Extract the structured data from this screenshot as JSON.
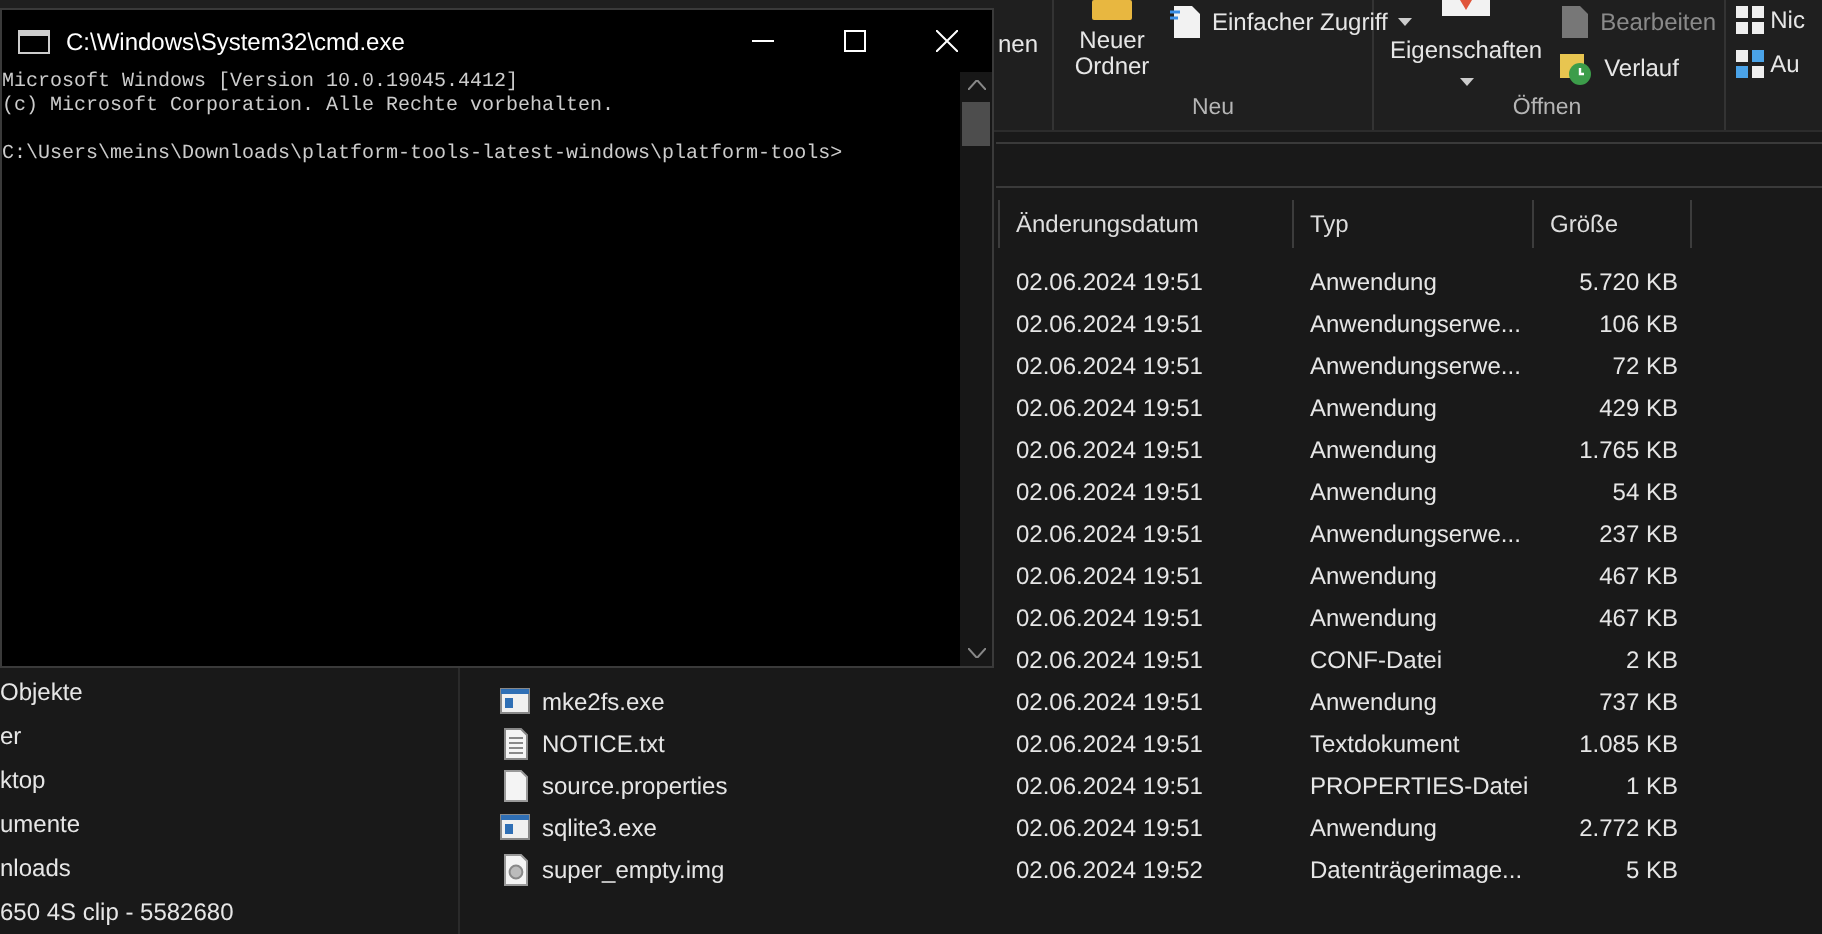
{
  "explorer": {
    "ribbon": {
      "cut_label": "nen",
      "groups": [
        {
          "label": "Neu",
          "large": {
            "label": "Neuer Ordner"
          },
          "small": [
            {
              "label": "Einfacher Zugriff",
              "caret": true
            }
          ]
        },
        {
          "label": "Öffnen",
          "large": {
            "label": "Eigenschaften",
            "caret": true
          },
          "small": [
            {
              "label": "Bearbeiten",
              "disabled": true
            },
            {
              "label": "Verlauf"
            }
          ]
        }
      ],
      "cut_items": [
        {
          "label": "Nic"
        },
        {
          "label": "Au"
        }
      ]
    },
    "sidebar": {
      "items": [
        "Objekte",
        "er",
        "ktop",
        "umente",
        "nloads",
        "650 4S clip - 5582680"
      ]
    },
    "columns": [
      "Änderungsdatum",
      "Typ",
      "Größe"
    ],
    "rows": [
      {
        "date": "02.06.2024 19:51",
        "type": "Anwendung",
        "size": "5.720 KB"
      },
      {
        "date": "02.06.2024 19:51",
        "type": "Anwendungserwe...",
        "size": "106 KB"
      },
      {
        "date": "02.06.2024 19:51",
        "type": "Anwendungserwe...",
        "size": "72 KB"
      },
      {
        "date": "02.06.2024 19:51",
        "type": "Anwendung",
        "size": "429 KB"
      },
      {
        "date": "02.06.2024 19:51",
        "type": "Anwendung",
        "size": "1.765 KB"
      },
      {
        "date": "02.06.2024 19:51",
        "type": "Anwendung",
        "size": "54 KB"
      },
      {
        "date": "02.06.2024 19:51",
        "type": "Anwendungserwe...",
        "size": "237 KB"
      },
      {
        "date": "02.06.2024 19:51",
        "type": "Anwendung",
        "size": "467 KB"
      },
      {
        "date": "02.06.2024 19:51",
        "type": "Anwendung",
        "size": "467 KB"
      },
      {
        "date": "02.06.2024 19:51",
        "type": "CONF-Datei",
        "size": "2 KB"
      },
      {
        "name": "mke2fs.exe",
        "kind": "exe",
        "date": "02.06.2024 19:51",
        "type": "Anwendung",
        "size": "737 KB"
      },
      {
        "name": "NOTICE.txt",
        "kind": "txt",
        "date": "02.06.2024 19:51",
        "type": "Textdokument",
        "size": "1.085 KB"
      },
      {
        "name": "source.properties",
        "kind": "file",
        "date": "02.06.2024 19:51",
        "type": "PROPERTIES-Datei",
        "size": "1 KB"
      },
      {
        "name": "sqlite3.exe",
        "kind": "exe",
        "date": "02.06.2024 19:51",
        "type": "Anwendung",
        "size": "2.772 KB"
      },
      {
        "name": "super_empty.img",
        "kind": "img",
        "date": "02.06.2024 19:52",
        "type": "Datenträgerimage...",
        "size": "5 KB"
      }
    ]
  },
  "console": {
    "title": "C:\\Windows\\System32\\cmd.exe",
    "output": [
      "Microsoft Windows [Version 10.0.19045.4412]",
      "(c) Microsoft Corporation. Alle Rechte vorbehalten."
    ],
    "prompt": "C:\\Users\\meins\\Downloads\\platform-tools-latest-windows\\platform-tools>"
  }
}
